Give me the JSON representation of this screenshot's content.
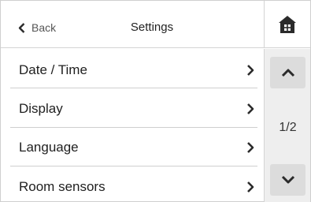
{
  "header": {
    "back_label": "Back",
    "title": "Settings",
    "back_icon": "chevron-left-icon",
    "home_icon": "home-icon"
  },
  "menu": {
    "items": [
      {
        "label": "Date / Time"
      },
      {
        "label": "Display"
      },
      {
        "label": "Language"
      },
      {
        "label": "Room sensors"
      }
    ],
    "item_icon": "chevron-right-icon"
  },
  "pager": {
    "page_indicator": "1/2",
    "up_icon": "chevron-up-icon",
    "down_icon": "chevron-down-icon"
  },
  "colors": {
    "icon_dark": "#2b2b2b",
    "pager_bg": "#eeeeee",
    "pager_button": "#dcdcdc",
    "divider": "#cfcfcf"
  }
}
